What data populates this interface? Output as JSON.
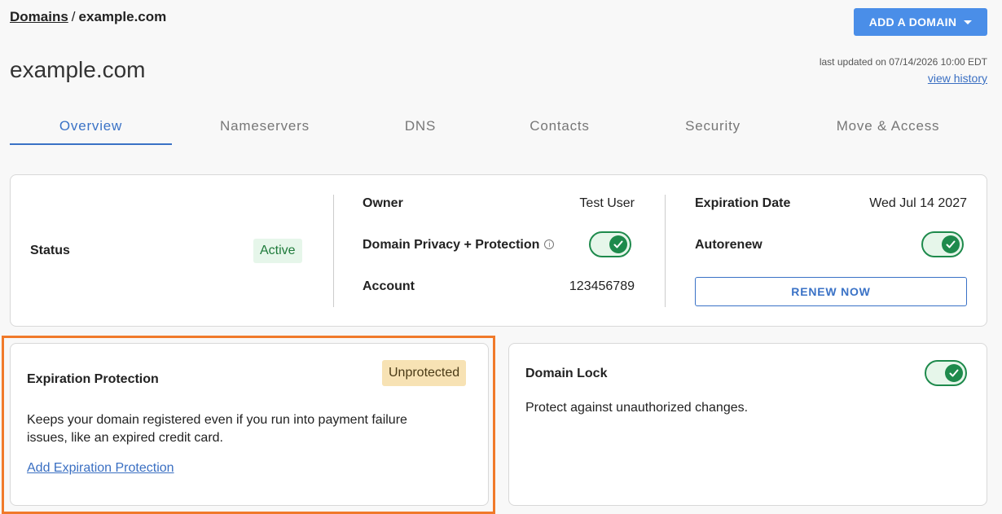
{
  "breadcrumb": {
    "root": "Domains",
    "separator": "/",
    "current": "example.com"
  },
  "header": {
    "add_domain_label": "ADD A DOMAIN",
    "title": "example.com",
    "last_updated": "last updated on 07/14/2026 10:00 EDT",
    "view_history": "view history"
  },
  "tabs": [
    "Overview",
    "Nameservers",
    "DNS",
    "Contacts",
    "Security",
    "Move & Access"
  ],
  "active_tab": "Overview",
  "overview": {
    "status_label": "Status",
    "status_value": "Active",
    "owner_label": "Owner",
    "owner_value": "Test User",
    "privacy_label": "Domain Privacy + Protection",
    "privacy_enabled": true,
    "account_label": "Account",
    "account_value": "123456789",
    "expiration_label": "Expiration Date",
    "expiration_value": "Wed Jul 14 2027",
    "autorenew_label": "Autorenew",
    "autorenew_enabled": true,
    "renew_label": "RENEW NOW"
  },
  "expiration_protection": {
    "title": "Expiration Protection",
    "badge": "Unprotected",
    "description_line1": "Keeps your domain registered even if you run into payment failure",
    "description_line2": "issues, like an expired credit card.",
    "link": "Add Expiration Protection"
  },
  "domain_lock": {
    "title": "Domain Lock",
    "enabled": true,
    "description": "Protect against unauthorized changes."
  },
  "colors": {
    "accent": "#3a72c6",
    "button_primary": "#4a8ee8",
    "toggle_on": "#1e8a4c",
    "highlight": "#f07a2a",
    "badge_warning": "#f7e2b4"
  }
}
